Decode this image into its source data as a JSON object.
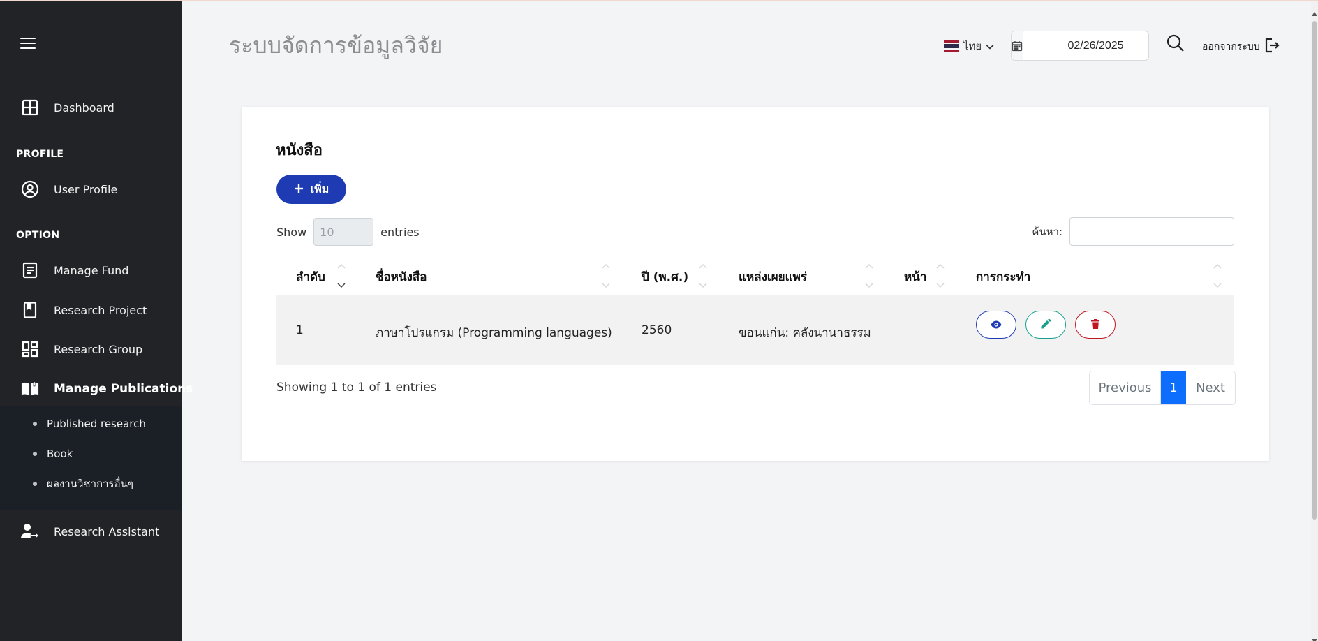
{
  "header": {
    "app_title": "ระบบจัดการข้อมูลวิจัย",
    "language": "ไทย",
    "date": "02/26/2025",
    "logout_label": "ออกจากระบบ"
  },
  "sidebar": {
    "dashboard": "Dashboard",
    "profile_section": "PROFILE",
    "user_profile": "User Profile",
    "option_section": "OPTION",
    "manage_fund": "Manage Fund",
    "research_project": "Research Project",
    "research_group": "Research Group",
    "manage_publications": "Manage Publications",
    "submenu": [
      "Published research",
      "Book",
      "ผลงานวิชาการอื่นๆ"
    ],
    "research_assistant": "Research Assistant"
  },
  "card": {
    "title": "หนังสือ",
    "add_label": "เพิ่ม",
    "show_label": "Show",
    "entries_value": "10",
    "entries_label": "entries",
    "search_label": "ค้นหา:",
    "columns": [
      "ลำดับ",
      "ชื่อหนังสือ",
      "ปี (พ.ศ.)",
      "แหล่งเผยแพร่",
      "หน้า",
      "การกระทำ"
    ],
    "rows": [
      {
        "no": "1",
        "title": "ภาษาโปรแกรม (Programming languages)",
        "year": "2560",
        "source": "ขอนแก่น: คลังนานาธรรม",
        "pages": ""
      }
    ],
    "info": "Showing 1 to 1 of 1 entries",
    "pagination": {
      "previous": "Previous",
      "current": "1",
      "next": "Next"
    }
  },
  "colors": {
    "sidebar_bg": "#222327",
    "submenu_bg": "#1b1f26",
    "primary": "#1f3bb3",
    "page_active": "#0d6efd",
    "view": "#1f3bb3",
    "edit": "#17a08f",
    "delete": "#c0161f"
  }
}
